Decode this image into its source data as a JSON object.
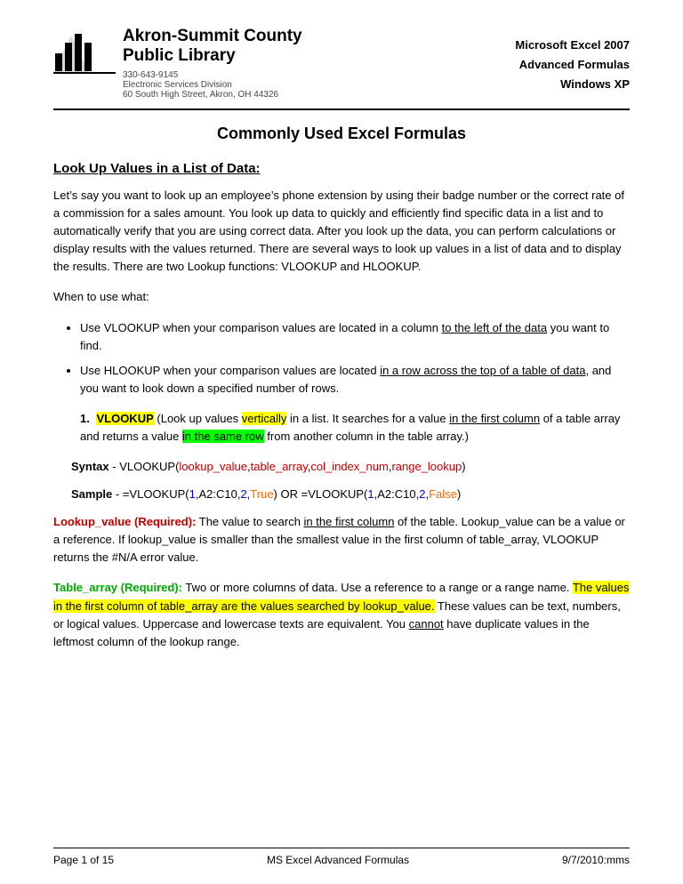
{
  "header": {
    "library_line1": "Akron-Summit County",
    "library_line2": "Public Library",
    "phone": "330-643-9145",
    "division": "Electronic Services Division",
    "address": "60 South High Street, Akron, OH 44326",
    "right_line1": "Microsoft Excel 2007",
    "right_line2": "Advanced Formulas",
    "right_line3": "Windows XP"
  },
  "page_title": "Commonly Used Excel Formulas",
  "section1_heading": "Look Up Values in a List of Data:",
  "intro_paragraph": "Let’s say you want to look up an employee’s phone extension by using their badge number or the correct rate of a commission for a sales amount. You look up data to quickly and efficiently find specific data in a list and to automatically verify that you are using correct data. After you look up the data, you can perform calculations or display results with the values returned. There are several ways to look up values in a list of data and to display the results.  There are two Lookup functions:   VLOOKUP and HLOOKUP.",
  "when_to_use": "When to use what:",
  "bullet1": "Use VLOOKUP when your comparison values are located in a column to the left of the data you want to find.",
  "bullet1_underline": "to the left of the data",
  "bullet2_pre": "Use HLOOKUP when your comparison values are located ",
  "bullet2_underline": "in a row across the top of a table of data",
  "bullet2_post": ", and you want to look down a specified number of rows.",
  "numbered_items": [
    {
      "num": "1.",
      "label": "VLOOKUP",
      "label_highlight": "yellow",
      "desc_pre": " (Look up values ",
      "desc_vert": "vertically",
      "desc_vert_highlight": "yellow",
      "desc_mid": " in a list.  It searches for a value ",
      "desc_underline": "in the first column",
      "desc_post": " of a table array and returns a value ",
      "desc_row": "in the same row",
      "desc_row_highlight": "green",
      "desc_end": " from another column in the table array.)"
    }
  ],
  "syntax_label": "Syntax",
  "syntax_dash": " - ",
  "syntax_func": "VLOOKUP(",
  "syntax_p1": "lookup_value",
  "syntax_comma1": ",",
  "syntax_p2": "table_array",
  "syntax_comma2": ",",
  "syntax_p3": "col_index_num",
  "syntax_comma3": ",",
  "syntax_p4": "range_lookup",
  "syntax_close": ")",
  "sample_label": "Sample",
  "sample_dash": " -  ",
  "sample_eq1": "=VLOOKUP(",
  "sample_1a": "1",
  "sample_1b": ",A2:C10,",
  "sample_1c": "2",
  "sample_1d": ",",
  "sample_1e": "True",
  "sample_1f": ")  OR   =VLOOKUP(",
  "sample_2a": "1",
  "sample_2b": ",A2:C10,",
  "sample_2c": "2",
  "sample_2d": ",",
  "sample_2e": "False",
  "sample_2f": ")",
  "lookup_value_title": "Lookup_value (Required):",
  "lookup_value_text": "  The value to search in the first column of the table. Lookup_value can be a value or a reference. If lookup_value is smaller than the smallest value in the first column of table_array, VLOOKUP returns the #N/A error value.",
  "lookup_value_underline": "in the first column",
  "table_array_title": "Table_array (Required):",
  "table_array_text_pre": "  Two or more columns of data. Use a reference to a range or a range name. ",
  "table_array_highlight": "The values in the first column of table_array are the values searched by lookup_value.",
  "table_array_text_post": " These values can be text, numbers, or logical values. Uppercase and lowercase texts are equivalent.  You ",
  "table_array_cannot": "cannot",
  "table_array_text_end": " have duplicate values in the leftmost column of the lookup range.",
  "footer_left": "Page 1 of 15",
  "footer_center": "MS Excel Advanced Formulas",
  "footer_right": "9/7/2010:mms"
}
